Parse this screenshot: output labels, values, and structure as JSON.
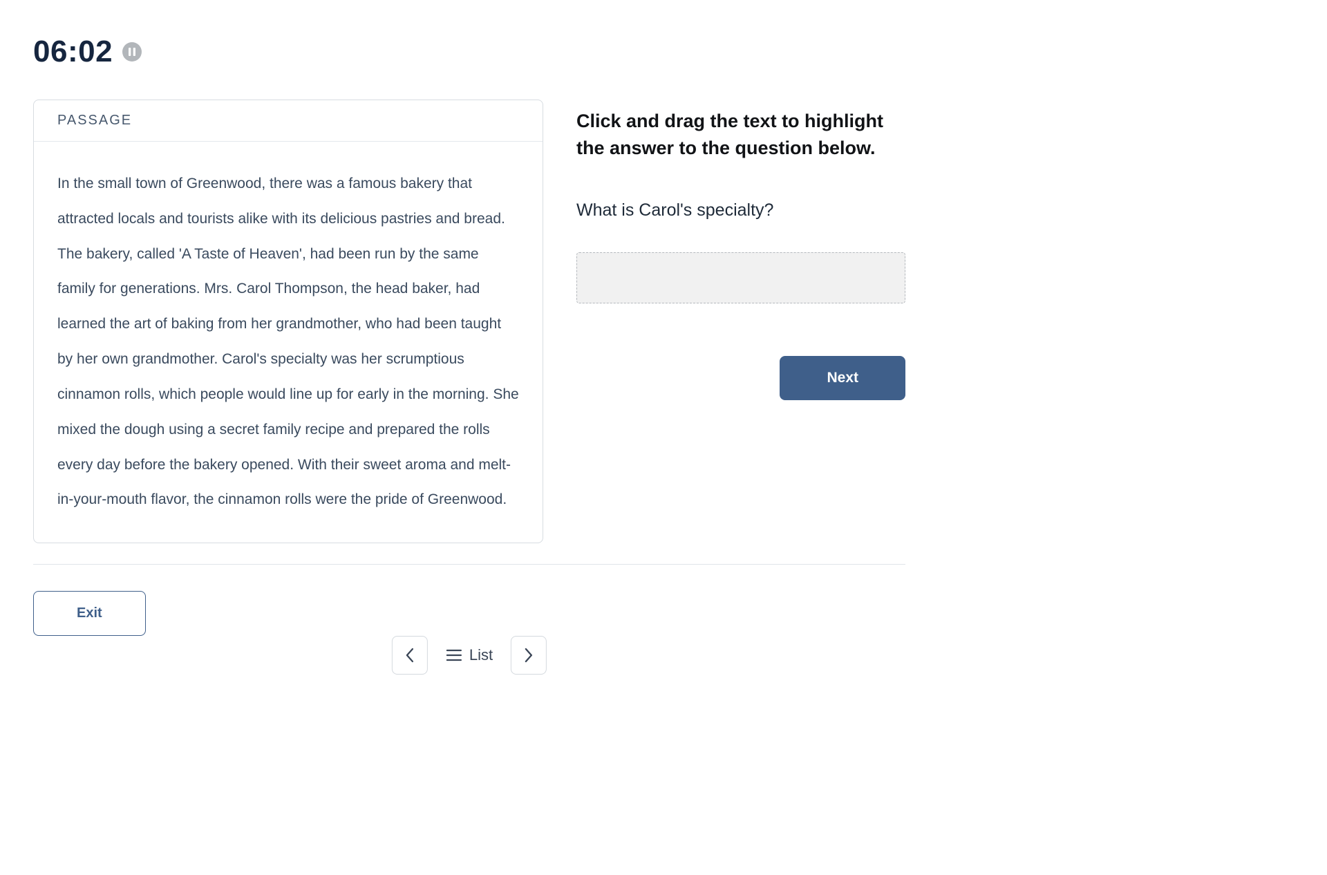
{
  "timer": {
    "value": "06:02"
  },
  "passage": {
    "header_label": "PASSAGE",
    "text": "In the small town of Greenwood, there was a famous bakery that attracted locals and tourists alike with its delicious pastries and bread. The bakery, called 'A Taste of Heaven', had been run by the same family for generations. Mrs. Carol Thompson, the head baker, had learned the art of baking from her grandmother, who had been taught by her own grandmother. Carol's specialty was her scrumptious cinnamon rolls, which people would line up for early in the morning. She mixed the dough using a secret family recipe and prepared the rolls every day before the bakery opened. With their sweet aroma and melt-in-your-mouth flavor, the cinnamon rolls were the pride of Greenwood."
  },
  "question": {
    "instruction": "Click and drag the text to highlight the answer to the question below.",
    "prompt": "What is Carol's specialty?"
  },
  "buttons": {
    "next": "Next",
    "exit": "Exit",
    "list": "List"
  },
  "colors": {
    "primary": "#3f5f8a",
    "text_dark": "#16263f"
  }
}
